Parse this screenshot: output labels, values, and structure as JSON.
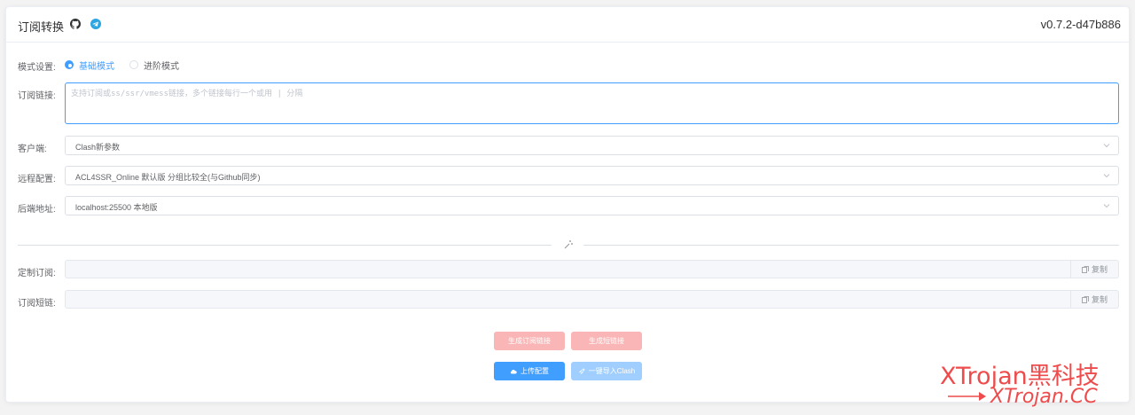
{
  "header": {
    "title": "订阅转换",
    "version": "v0.7.2-d47b886",
    "icons": [
      "github-icon",
      "telegram-icon"
    ]
  },
  "mode": {
    "label": "模式设置:",
    "options": [
      {
        "label": "基础模式",
        "selected": true
      },
      {
        "label": "进阶模式",
        "selected": false
      }
    ]
  },
  "subscription": {
    "label": "订阅链接:",
    "placeholder": "支持订阅或ss/ssr/vmess链接，多个链接每行一个或用 | 分隔",
    "value": ""
  },
  "client": {
    "label": "客户端:",
    "value": "Clash新参数"
  },
  "remote_config": {
    "label": "远程配置:",
    "value": "ACL4SSR_Online 默认版 分组比较全(与Github同步)"
  },
  "backend": {
    "label": "后端地址:",
    "value": "localhost:25500 本地版"
  },
  "custom_sub": {
    "label": "定制订阅:",
    "value": "",
    "copy_label": "复制"
  },
  "short_link": {
    "label": "订阅短链:",
    "value": "",
    "copy_label": "复制"
  },
  "buttons": {
    "generate_sub": "生成订阅链接",
    "generate_short": "生成短链接",
    "upload_config": "上传配置",
    "import_clash": "一键导入Clash"
  },
  "colors": {
    "primary": "#409eff",
    "danger_light": "#fab6b6",
    "primary_light": "#a0cfff",
    "watermark": "#ee4c4c"
  },
  "watermark": {
    "line1": "XTrojan黑科技",
    "line2": "XTrojan.CC"
  }
}
